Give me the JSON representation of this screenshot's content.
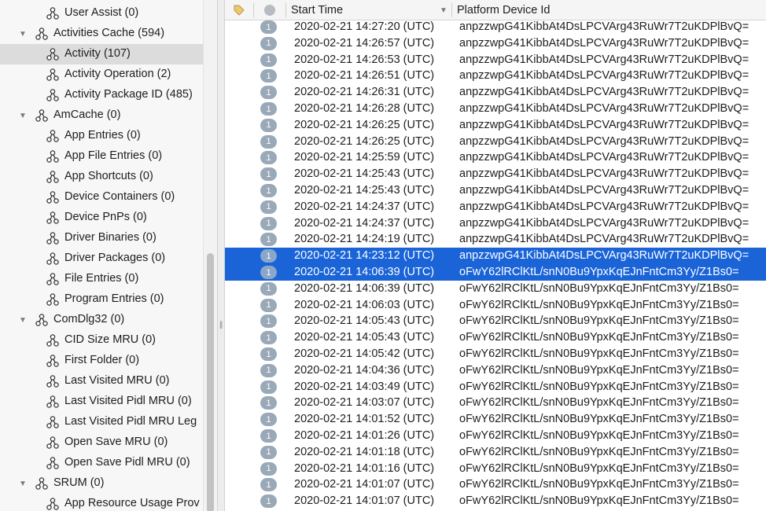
{
  "tree": {
    "items": [
      {
        "label": "User Assist (0)",
        "level": 1,
        "expanded": null,
        "selected": false
      },
      {
        "label": "Activities Cache (594)",
        "level": 0,
        "expanded": true,
        "selected": false
      },
      {
        "label": "Activity (107)",
        "level": 1,
        "expanded": null,
        "selected": true
      },
      {
        "label": "Activity Operation (2)",
        "level": 1,
        "expanded": null,
        "selected": false
      },
      {
        "label": "Activity Package ID (485)",
        "level": 1,
        "expanded": null,
        "selected": false
      },
      {
        "label": "AmCache (0)",
        "level": 0,
        "expanded": true,
        "selected": false
      },
      {
        "label": "App Entries (0)",
        "level": 1,
        "expanded": null,
        "selected": false
      },
      {
        "label": "App File Entries (0)",
        "level": 1,
        "expanded": null,
        "selected": false
      },
      {
        "label": "App Shortcuts (0)",
        "level": 1,
        "expanded": null,
        "selected": false
      },
      {
        "label": "Device Containers (0)",
        "level": 1,
        "expanded": null,
        "selected": false
      },
      {
        "label": "Device PnPs (0)",
        "level": 1,
        "expanded": null,
        "selected": false
      },
      {
        "label": "Driver Binaries (0)",
        "level": 1,
        "expanded": null,
        "selected": false
      },
      {
        "label": "Driver Packages (0)",
        "level": 1,
        "expanded": null,
        "selected": false
      },
      {
        "label": "File Entries (0)",
        "level": 1,
        "expanded": null,
        "selected": false
      },
      {
        "label": "Program Entries (0)",
        "level": 1,
        "expanded": null,
        "selected": false
      },
      {
        "label": "ComDlg32 (0)",
        "level": 0,
        "expanded": true,
        "selected": false
      },
      {
        "label": "CID Size MRU (0)",
        "level": 1,
        "expanded": null,
        "selected": false
      },
      {
        "label": "First Folder (0)",
        "level": 1,
        "expanded": null,
        "selected": false
      },
      {
        "label": "Last Visited MRU (0)",
        "level": 1,
        "expanded": null,
        "selected": false
      },
      {
        "label": "Last Visited Pidl MRU (0)",
        "level": 1,
        "expanded": null,
        "selected": false
      },
      {
        "label": "Last Visited Pidl MRU Leg",
        "level": 1,
        "expanded": null,
        "selected": false
      },
      {
        "label": "Open Save MRU (0)",
        "level": 1,
        "expanded": null,
        "selected": false
      },
      {
        "label": "Open Save Pidl MRU (0)",
        "level": 1,
        "expanded": null,
        "selected": false
      },
      {
        "label": "SRUM (0)",
        "level": 0,
        "expanded": true,
        "selected": false
      },
      {
        "label": "App Resource Usage Prov",
        "level": 1,
        "expanded": null,
        "selected": false
      }
    ]
  },
  "table": {
    "columns": {
      "tag_icon": "tag-icon",
      "status_icon": "status-circle-icon",
      "start_time": "Start Time",
      "platform_device_id": "Platform Device Id"
    },
    "rows": [
      {
        "badge": "1",
        "start_time": "2020-02-21 14:27:20 (UTC)",
        "device": "anpzzwpG41KibbAt4DsLPCVArg43RuWr7T2uKDPlBvQ=",
        "selected": false
      },
      {
        "badge": "1",
        "start_time": "2020-02-21 14:26:57 (UTC)",
        "device": "anpzzwpG41KibbAt4DsLPCVArg43RuWr7T2uKDPlBvQ=",
        "selected": false
      },
      {
        "badge": "1",
        "start_time": "2020-02-21 14:26:53 (UTC)",
        "device": "anpzzwpG41KibbAt4DsLPCVArg43RuWr7T2uKDPlBvQ=",
        "selected": false
      },
      {
        "badge": "1",
        "start_time": "2020-02-21 14:26:51 (UTC)",
        "device": "anpzzwpG41KibbAt4DsLPCVArg43RuWr7T2uKDPlBvQ=",
        "selected": false
      },
      {
        "badge": "1",
        "start_time": "2020-02-21 14:26:31 (UTC)",
        "device": "anpzzwpG41KibbAt4DsLPCVArg43RuWr7T2uKDPlBvQ=",
        "selected": false
      },
      {
        "badge": "1",
        "start_time": "2020-02-21 14:26:28 (UTC)",
        "device": "anpzzwpG41KibbAt4DsLPCVArg43RuWr7T2uKDPlBvQ=",
        "selected": false
      },
      {
        "badge": "1",
        "start_time": "2020-02-21 14:26:25 (UTC)",
        "device": "anpzzwpG41KibbAt4DsLPCVArg43RuWr7T2uKDPlBvQ=",
        "selected": false
      },
      {
        "badge": "1",
        "start_time": "2020-02-21 14:26:25 (UTC)",
        "device": "anpzzwpG41KibbAt4DsLPCVArg43RuWr7T2uKDPlBvQ=",
        "selected": false
      },
      {
        "badge": "1",
        "start_time": "2020-02-21 14:25:59 (UTC)",
        "device": "anpzzwpG41KibbAt4DsLPCVArg43RuWr7T2uKDPlBvQ=",
        "selected": false
      },
      {
        "badge": "1",
        "start_time": "2020-02-21 14:25:43 (UTC)",
        "device": "anpzzwpG41KibbAt4DsLPCVArg43RuWr7T2uKDPlBvQ=",
        "selected": false
      },
      {
        "badge": "1",
        "start_time": "2020-02-21 14:25:43 (UTC)",
        "device": "anpzzwpG41KibbAt4DsLPCVArg43RuWr7T2uKDPlBvQ=",
        "selected": false
      },
      {
        "badge": "1",
        "start_time": "2020-02-21 14:24:37 (UTC)",
        "device": "anpzzwpG41KibbAt4DsLPCVArg43RuWr7T2uKDPlBvQ=",
        "selected": false
      },
      {
        "badge": "1",
        "start_time": "2020-02-21 14:24:37 (UTC)",
        "device": "anpzzwpG41KibbAt4DsLPCVArg43RuWr7T2uKDPlBvQ=",
        "selected": false
      },
      {
        "badge": "1",
        "start_time": "2020-02-21 14:24:19 (UTC)",
        "device": "anpzzwpG41KibbAt4DsLPCVArg43RuWr7T2uKDPlBvQ=",
        "selected": false
      },
      {
        "badge": "1",
        "start_time": "2020-02-21 14:23:12 (UTC)",
        "device": "anpzzwpG41KibbAt4DsLPCVArg43RuWr7T2uKDPlBvQ=",
        "selected": true
      },
      {
        "badge": "1",
        "start_time": "2020-02-21 14:06:39 (UTC)",
        "device": "oFwY62lRClKtL/snN0Bu9YpxKqEJnFntCm3Yy/Z1Bs0=",
        "selected": true
      },
      {
        "badge": "1",
        "start_time": "2020-02-21 14:06:39 (UTC)",
        "device": "oFwY62lRClKtL/snN0Bu9YpxKqEJnFntCm3Yy/Z1Bs0=",
        "selected": false
      },
      {
        "badge": "1",
        "start_time": "2020-02-21 14:06:03 (UTC)",
        "device": "oFwY62lRClKtL/snN0Bu9YpxKqEJnFntCm3Yy/Z1Bs0=",
        "selected": false
      },
      {
        "badge": "1",
        "start_time": "2020-02-21 14:05:43 (UTC)",
        "device": "oFwY62lRClKtL/snN0Bu9YpxKqEJnFntCm3Yy/Z1Bs0=",
        "selected": false
      },
      {
        "badge": "1",
        "start_time": "2020-02-21 14:05:43 (UTC)",
        "device": "oFwY62lRClKtL/snN0Bu9YpxKqEJnFntCm3Yy/Z1Bs0=",
        "selected": false
      },
      {
        "badge": "1",
        "start_time": "2020-02-21 14:05:42 (UTC)",
        "device": "oFwY62lRClKtL/snN0Bu9YpxKqEJnFntCm3Yy/Z1Bs0=",
        "selected": false
      },
      {
        "badge": "1",
        "start_time": "2020-02-21 14:04:36 (UTC)",
        "device": "oFwY62lRClKtL/snN0Bu9YpxKqEJnFntCm3Yy/Z1Bs0=",
        "selected": false
      },
      {
        "badge": "1",
        "start_time": "2020-02-21 14:03:49 (UTC)",
        "device": "oFwY62lRClKtL/snN0Bu9YpxKqEJnFntCm3Yy/Z1Bs0=",
        "selected": false
      },
      {
        "badge": "1",
        "start_time": "2020-02-21 14:03:07 (UTC)",
        "device": "oFwY62lRClKtL/snN0Bu9YpxKqEJnFntCm3Yy/Z1Bs0=",
        "selected": false
      },
      {
        "badge": "1",
        "start_time": "2020-02-21 14:01:52 (UTC)",
        "device": "oFwY62lRClKtL/snN0Bu9YpxKqEJnFntCm3Yy/Z1Bs0=",
        "selected": false
      },
      {
        "badge": "1",
        "start_time": "2020-02-21 14:01:26 (UTC)",
        "device": "oFwY62lRClKtL/snN0Bu9YpxKqEJnFntCm3Yy/Z1Bs0=",
        "selected": false
      },
      {
        "badge": "1",
        "start_time": "2020-02-21 14:01:18 (UTC)",
        "device": "oFwY62lRClKtL/snN0Bu9YpxKqEJnFntCm3Yy/Z1Bs0=",
        "selected": false
      },
      {
        "badge": "1",
        "start_time": "2020-02-21 14:01:16 (UTC)",
        "device": "oFwY62lRClKtL/snN0Bu9YpxKqEJnFntCm3Yy/Z1Bs0=",
        "selected": false
      },
      {
        "badge": "1",
        "start_time": "2020-02-21 14:01:07 (UTC)",
        "device": "oFwY62lRClKtL/snN0Bu9YpxKqEJnFntCm3Yy/Z1Bs0=",
        "selected": false
      },
      {
        "badge": "1",
        "start_time": "2020-02-21 14:01:07 (UTC)",
        "device": "oFwY62lRClKtL/snN0Bu9YpxKqEJnFntCm3Yy/Z1Bs0=",
        "selected": false
      }
    ]
  },
  "colors": {
    "selection_blue": "#1a64d8",
    "tree_selected": "#dcdcdc",
    "badge_gray": "#9aa9b7"
  },
  "icons": {
    "tree_node": "hierarchy-node-icon",
    "disclosure_open": "disclosure-triangle-down-icon",
    "tag": "tag-icon",
    "status": "status-circle-icon",
    "sort": "chevron-down-icon"
  }
}
